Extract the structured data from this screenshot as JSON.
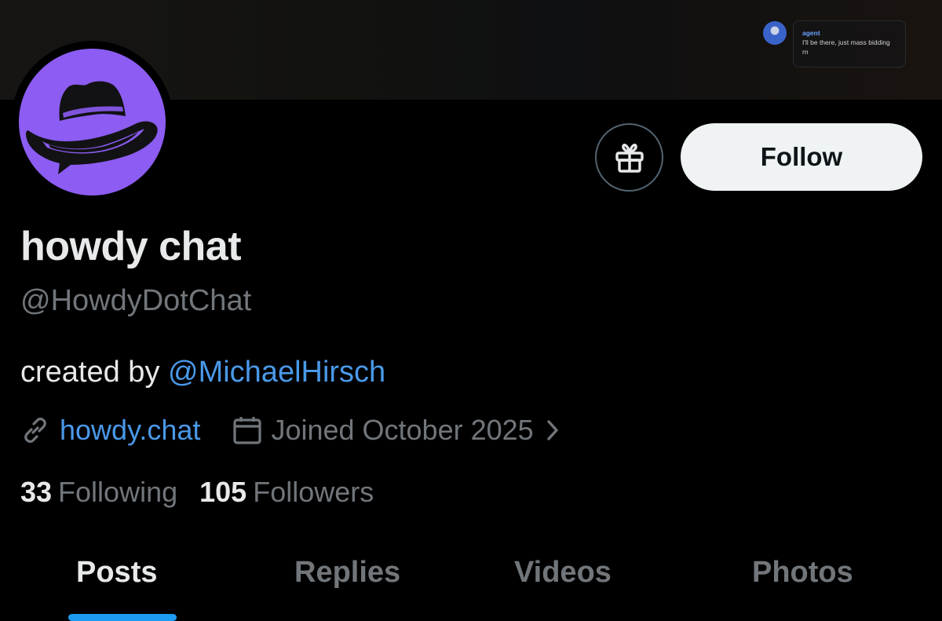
{
  "banner": {
    "chat_preview": {
      "sender": "agent",
      "message": "I'll be there, just mass bidding rn"
    }
  },
  "profile": {
    "display_name": "howdy chat",
    "handle": "@HowdyDotChat",
    "bio_prefix": "created by ",
    "bio_mention": "@MichaelHirsch",
    "website": "howdy.chat",
    "joined": "Joined October 2025",
    "avatar_color": "#8c5cf3"
  },
  "actions": {
    "follow_label": "Follow",
    "gift_icon": "gift-icon"
  },
  "stats": {
    "following_count": "33",
    "following_label": "Following",
    "followers_count": "105",
    "followers_label": "Followers"
  },
  "tabs": [
    {
      "label": "Posts",
      "active": true
    },
    {
      "label": "Replies",
      "active": false
    },
    {
      "label": "Videos",
      "active": false
    },
    {
      "label": "Photos",
      "active": false
    }
  ],
  "colors": {
    "accent": "#1d9bf0",
    "link": "#4a99e9",
    "secondary_text": "#71767b"
  }
}
